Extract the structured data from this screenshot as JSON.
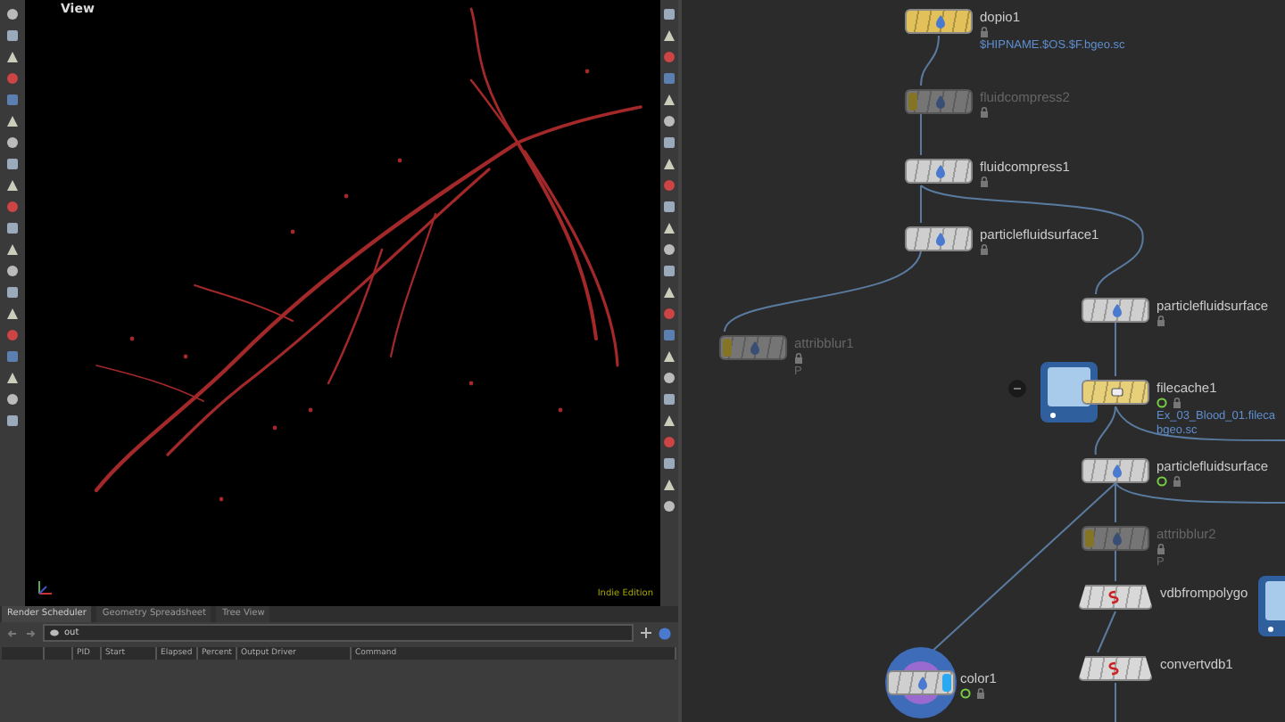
{
  "viewport": {
    "title": "View",
    "edition": "Indie Edition"
  },
  "bottom_panel": {
    "tabs": [
      {
        "label": "Render Scheduler",
        "selected": true
      },
      {
        "label": "Geometry Spreadsheet",
        "selected": false
      },
      {
        "label": "Tree View",
        "selected": false
      }
    ],
    "path": "out",
    "columns": [
      "PID",
      "Start",
      "Elapsed",
      "Percent",
      "Output Driver",
      "Command"
    ]
  },
  "network": {
    "nodes": [
      {
        "name": "dopio1",
        "kind": "folder",
        "bypassed": false,
        "display": false,
        "ring": false,
        "locked": true,
        "details": [
          "$HIPNAME.$OS.$F.bgeo.sc"
        ]
      },
      {
        "name": "fluidcompress2",
        "kind": "sop",
        "bypassed": true,
        "display": false,
        "ring": false,
        "locked": true
      },
      {
        "name": "fluidcompress1",
        "kind": "sop",
        "bypassed": false,
        "display": false,
        "ring": false,
        "locked": true
      },
      {
        "name": "particlefluidsurface1",
        "kind": "sop",
        "bypassed": false,
        "display": false,
        "ring": false,
        "locked": true
      },
      {
        "name": "particlefluidsurface",
        "kind": "sop",
        "bypassed": false,
        "display": false,
        "ring": false,
        "locked": true
      },
      {
        "name": "attribblur1",
        "kind": "sop",
        "bypassed": true,
        "display": false,
        "ring": false,
        "locked": true,
        "details": [
          "P"
        ]
      },
      {
        "name": "filecache1",
        "kind": "filecache",
        "bypassed": false,
        "display": false,
        "ring": true,
        "locked": true,
        "details": [
          "Ex_03_Blood_01.fileca",
          "bgeo.sc"
        ]
      },
      {
        "name": "particlefluidsurface",
        "kind": "sop",
        "bypassed": false,
        "display": false,
        "ring": true,
        "locked": true
      },
      {
        "name": "attribblur2",
        "kind": "sop",
        "bypassed": true,
        "display": false,
        "ring": false,
        "locked": true,
        "details": [
          "P"
        ]
      },
      {
        "name": "vdbfrompolygo",
        "kind": "vdb",
        "bypassed": false,
        "display": false,
        "ring": false,
        "locked": false
      },
      {
        "name": "convertvdb1",
        "kind": "vdb",
        "bypassed": false,
        "display": false,
        "ring": false,
        "locked": false
      },
      {
        "name": "color1",
        "kind": "sop",
        "bypassed": false,
        "display": true,
        "ring": true,
        "locked": true
      }
    ]
  }
}
